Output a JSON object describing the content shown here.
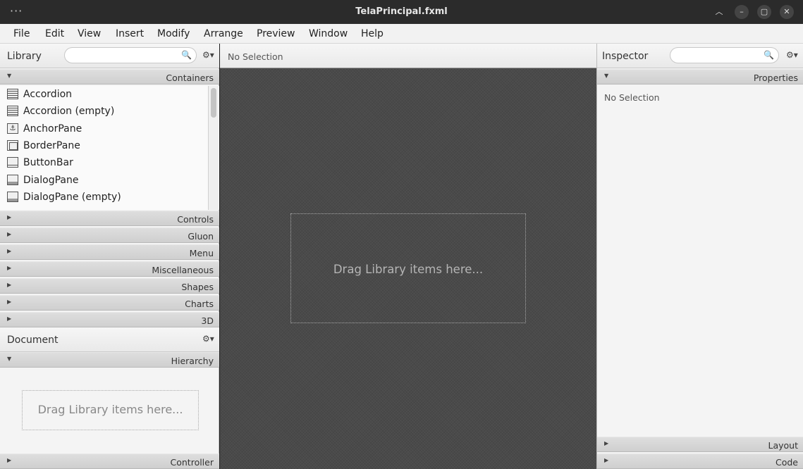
{
  "window": {
    "title": "TelaPrincipal.fxml",
    "menu_dots": "···",
    "minimize": "–",
    "maximize": "▢",
    "close": "✕",
    "collapse": "︿"
  },
  "menu": [
    "File",
    "Edit",
    "View",
    "Insert",
    "Modify",
    "Arrange",
    "Preview",
    "Window",
    "Help"
  ],
  "library": {
    "title": "Library",
    "search_placeholder": "",
    "sections": {
      "containers": "Containers",
      "controls": "Controls",
      "gluon": "Gluon",
      "menu": "Menu",
      "misc": "Miscellaneous",
      "shapes": "Shapes",
      "charts": "Charts",
      "three_d": "3D"
    },
    "items": [
      {
        "label": "Accordion",
        "icon": "accordion-icon"
      },
      {
        "label": "Accordion  (empty)",
        "icon": "accordion-icon"
      },
      {
        "label": "AnchorPane",
        "icon": "anchorpane-icon"
      },
      {
        "label": "BorderPane",
        "icon": "borderpane-icon"
      },
      {
        "label": "ButtonBar",
        "icon": "buttonbar-icon"
      },
      {
        "label": "DialogPane",
        "icon": "dialogpane-icon"
      },
      {
        "label": "DialogPane  (empty)",
        "icon": "dialogpane-icon"
      }
    ]
  },
  "document": {
    "title": "Document",
    "hierarchy": "Hierarchy",
    "controller": "Controller",
    "drop_hint": "Drag Library items here..."
  },
  "canvas": {
    "selection": "No Selection",
    "drop_hint": "Drag Library items here..."
  },
  "inspector": {
    "title": "Inspector",
    "properties": "Properties",
    "no_selection": "No Selection",
    "layout": "Layout",
    "code": "Code"
  },
  "icons": {
    "search": "🔍",
    "gear": "⚙▾",
    "collapsed": "▶",
    "expanded": "▼"
  }
}
